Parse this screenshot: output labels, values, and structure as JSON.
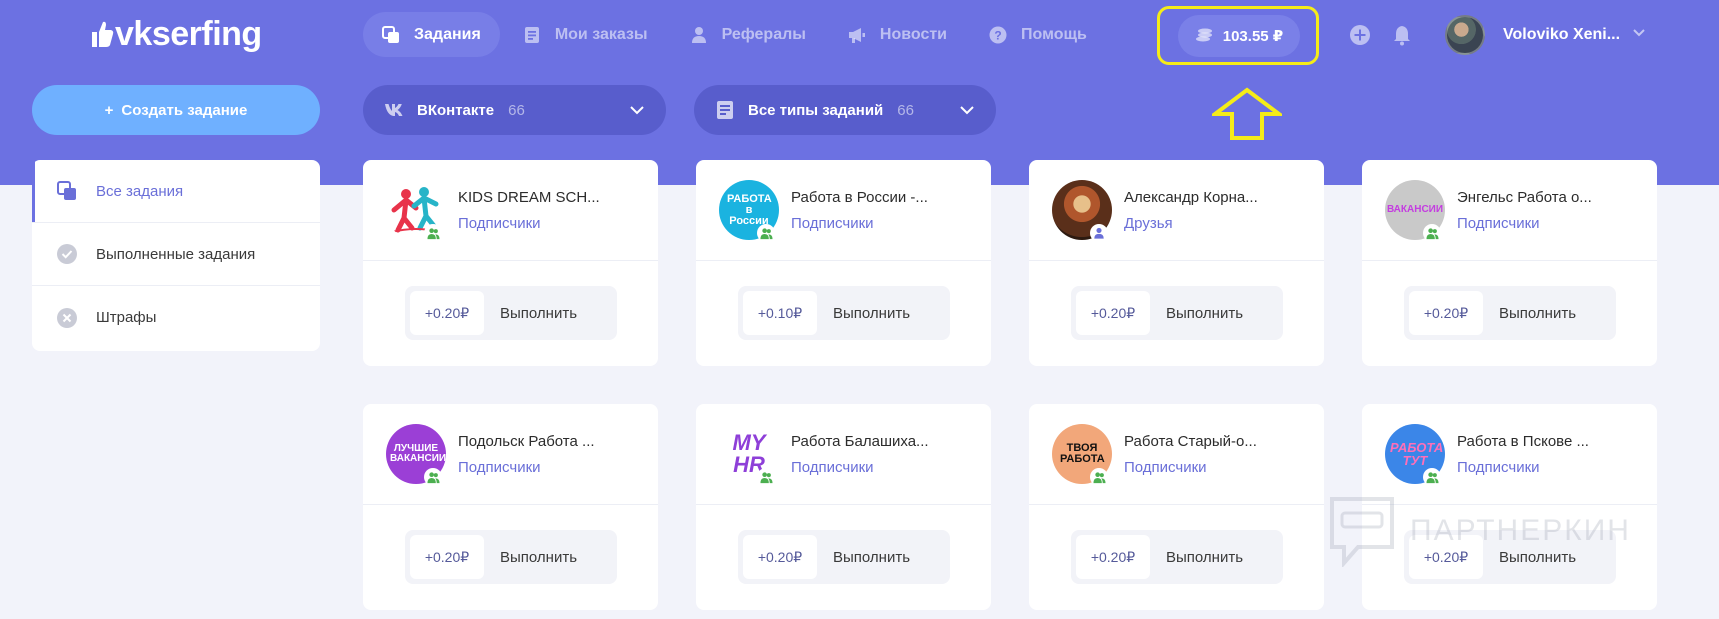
{
  "logo": {
    "text": "vkserfing"
  },
  "nav": {
    "items": [
      {
        "label": "Задания",
        "icon": "copy-icon",
        "active": true
      },
      {
        "label": "Мои заказы",
        "icon": "document-icon",
        "active": false
      },
      {
        "label": "Рефералы",
        "icon": "person-icon",
        "active": false
      },
      {
        "label": "Новости",
        "icon": "megaphone-icon",
        "active": false
      },
      {
        "label": "Помощь",
        "icon": "help-icon",
        "active": false
      }
    ]
  },
  "header": {
    "balance": "103.55 ₽",
    "user_name": "Voloviko Xeni..."
  },
  "toolbar": {
    "create_label": "Создать задание",
    "network_filter": {
      "label": "ВКонтакте",
      "count": "66"
    },
    "type_filter": {
      "label": "Все типы заданий",
      "count": "66"
    }
  },
  "sidebar": {
    "items": [
      {
        "label": "Все задания",
        "icon": "copy-icon",
        "active": true
      },
      {
        "label": "Выполненные задания",
        "icon": "check-circle-icon",
        "active": false
      },
      {
        "label": "Штрафы",
        "icon": "x-circle-icon",
        "active": false
      }
    ]
  },
  "tasks": [
    {
      "name": "KIDS DREAM SCH...",
      "type": "Подписчики",
      "price": "+0.20₽",
      "action": "Выполнить",
      "avatar_text": "",
      "avatar_color": "#ffffff"
    },
    {
      "name": "Работа в России -...",
      "type": "Подписчики",
      "price": "+0.10₽",
      "action": "Выполнить",
      "avatar_text": "РАБОТА в России",
      "avatar_color": "#1ab3e0"
    },
    {
      "name": "Александр Корна...",
      "type": "Друзья",
      "price": "+0.20₽",
      "action": "Выполнить",
      "avatar_text": "",
      "avatar_color": "#7a4a2a"
    },
    {
      "name": "Энгельс Работа о...",
      "type": "Подписчики",
      "price": "+0.20₽",
      "action": "Выполнить",
      "avatar_text": "ВАКАНСИИ",
      "avatar_color": "#c9c9c9"
    },
    {
      "name": "Подольск Работа ...",
      "type": "Подписчики",
      "price": "+0.20₽",
      "action": "Выполнить",
      "avatar_text": "ЛУЧШИЕ ВАКАНСИИ",
      "avatar_color": "#9b3fd6"
    },
    {
      "name": "Работа Балашиха...",
      "type": "Подписчики",
      "price": "+0.20₽",
      "action": "Выполнить",
      "avatar_text": "MY HR",
      "avatar_color": "#ffffff"
    },
    {
      "name": "Работа Старый-о...",
      "type": "Подписчики",
      "price": "+0.20₽",
      "action": "Выполнить",
      "avatar_text": "ТВОЯ РАБОТА",
      "avatar_color": "#f2a77a"
    },
    {
      "name": "Работа в Пскове ...",
      "type": "Подписчики",
      "price": "+0.20₽",
      "action": "Выполнить",
      "avatar_text": "РАБОТА ТУТ",
      "avatar_color": "#3b86e8"
    }
  ],
  "watermark": "ПАРТНЕРКИН",
  "colors": {
    "header": "#6c71e2",
    "accent": "#6a6fd8",
    "highlight": "#f5ec18",
    "create_button": "#6fb0ff"
  }
}
